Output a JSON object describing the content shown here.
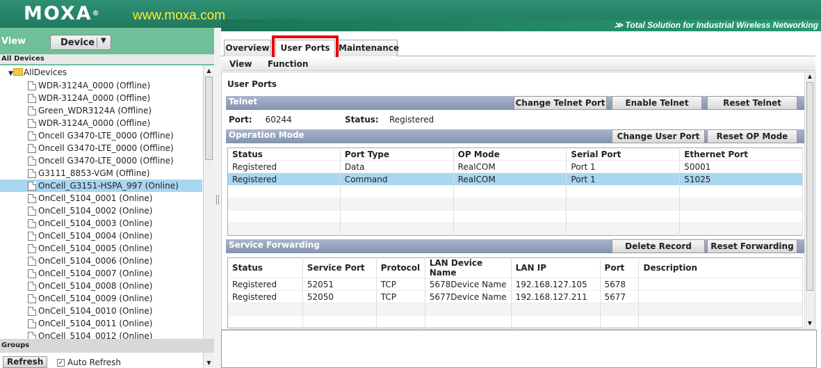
{
  "header": {
    "logo": "MOXA",
    "logo_mark": "®",
    "url": "www.moxa.com",
    "tagline": "≫ Total Solution for Industrial Wireless Networking"
  },
  "left": {
    "view_label": "View",
    "view_select": "Device",
    "all_devices": "All Devices",
    "root": "AllDevices",
    "devices": [
      "WDR-3124A_0000 (Offline)",
      "WDR-3124A_0000 (Offline)",
      "Green_WDR3124A (Offline)",
      "WDR-3124A_0000 (Offline)",
      "Oncell G3470-LTE_0000 (Offline)",
      "Oncell G3470-LTE_0000 (Offline)",
      "Oncell G3470-LTE_0000 (Offline)",
      "G3111_8853-VGM (Offline)",
      "OnCell_G3151-HSPA_997 (Online)",
      "OnCell_5104_0001 (Online)",
      "OnCell_5104_0002 (Online)",
      "OnCell_5104_0003 (Online)",
      "OnCell_5104_0004 (Online)",
      "OnCell_5104_0005 (Online)",
      "OnCell_5104_0006 (Online)",
      "OnCell_5104_0007 (Online)",
      "OnCell_5104_0008 (Online)",
      "OnCell_5104_0009 (Online)",
      "OnCell_5104_0010 (Online)",
      "OnCell_5104_0011 (Online)",
      "OnCell_5104_0012 (Online)"
    ],
    "groups": "Groups",
    "refresh": "Refresh",
    "auto_refresh": "Auto Refresh"
  },
  "tabs": [
    "Overview",
    "User Ports",
    "Maintenance"
  ],
  "subtabs": [
    "View",
    "Function"
  ],
  "panel_title": "User Ports",
  "telnet": {
    "title": "Telnet",
    "buttons": [
      "Change Telnet Port",
      "Enable Telnet",
      "Reset Telnet"
    ],
    "port_label": "Port:",
    "port_value": "60244",
    "status_label": "Status:",
    "status_value": "Registered"
  },
  "op_mode": {
    "title": "Operation Mode",
    "buttons": [
      "Change User Port",
      "Reset OP Mode"
    ],
    "columns": [
      "Status",
      "Port Type",
      "OP Mode",
      "Serial Port",
      "Ethernet Port"
    ],
    "rows": [
      [
        "Registered",
        "Data",
        "RealCOM",
        "Port 1",
        "50001"
      ],
      [
        "Registered",
        "Command",
        "RealCOM",
        "Port 1",
        "51025"
      ]
    ]
  },
  "forwarding": {
    "title": "Service Forwarding",
    "buttons": [
      "Delete Record",
      "Reset Forwarding"
    ],
    "columns": [
      "Status",
      "Service Port",
      "Protocol",
      "LAN Device Name",
      "LAN IP",
      "Port",
      "Description"
    ],
    "rows": [
      [
        "Registered",
        "52051",
        "TCP",
        "5678Device Name",
        "192.168.127.105",
        "5678",
        ""
      ],
      [
        "Registered",
        "52050",
        "TCP",
        "5677Device Name",
        "192.168.127.211",
        "5677",
        ""
      ]
    ]
  }
}
